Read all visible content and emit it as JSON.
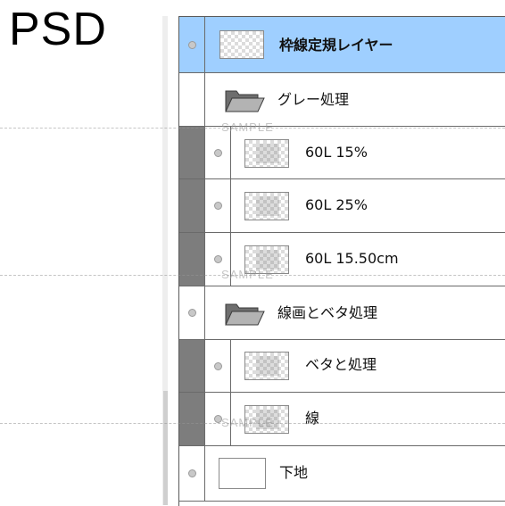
{
  "app_label": "PSD",
  "watermark": "SAMPLE",
  "layers": [
    {
      "name": "枠線定規レイヤー",
      "type": "layer",
      "selected": true,
      "bold": true
    },
    {
      "name": "グレー処理",
      "type": "folder",
      "open": true
    },
    {
      "name": "60L 15%",
      "type": "layer",
      "in_folder": true
    },
    {
      "name": "60L 25%",
      "type": "layer",
      "in_folder": true
    },
    {
      "name": "60L 15.50cm",
      "type": "layer",
      "in_folder": true
    },
    {
      "name": "線画とベタ処理",
      "type": "folder",
      "open": true
    },
    {
      "name": "ベタと処理",
      "type": "layer",
      "in_folder": true
    },
    {
      "name": "線",
      "type": "layer",
      "in_folder": true
    },
    {
      "name": "下地",
      "type": "layer",
      "thumbnail": "plain"
    }
  ],
  "colors": {
    "selected_row": "#9fcfff",
    "folder_member_bar": "#7d7d7d"
  }
}
